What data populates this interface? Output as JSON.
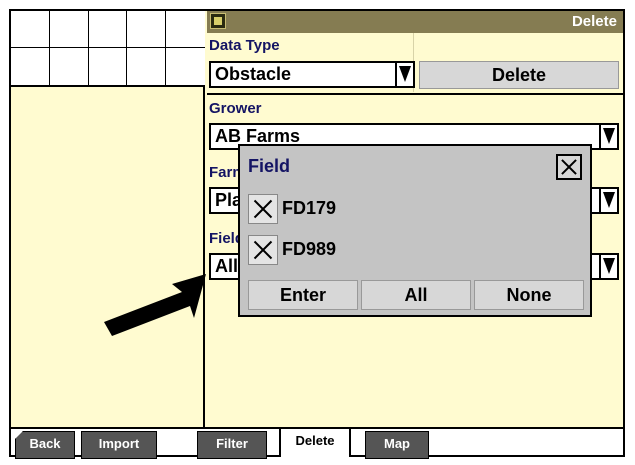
{
  "window": {
    "title": "Delete"
  },
  "data_type": {
    "label": "Data Type",
    "value": "Obstacle",
    "delete_button": "Delete"
  },
  "grower": {
    "label": "Grower",
    "value": "AB Farms"
  },
  "farm": {
    "label": "Farm",
    "value": "Pla"
  },
  "field": {
    "label": "Field",
    "value": "All"
  },
  "popup": {
    "title": "Field",
    "items": [
      {
        "label": "FD179",
        "checked": true
      },
      {
        "label": "FD989",
        "checked": true
      }
    ],
    "buttons": {
      "enter": "Enter",
      "all": "All",
      "none": "None"
    }
  },
  "tabs": {
    "back": "Back",
    "import": "Import",
    "filter": "Filter",
    "delete": "Delete",
    "map": "Map"
  },
  "icons": {
    "app": "app-icon",
    "close": "close-icon",
    "dropdown": "chevron-down-icon",
    "pointer": "arrow-pointer-icon"
  },
  "colors": {
    "background": "#fffbd0",
    "titlebar": "#857c52",
    "label": "#141464",
    "popup": "#c4c4c4",
    "tab": "#555555"
  }
}
